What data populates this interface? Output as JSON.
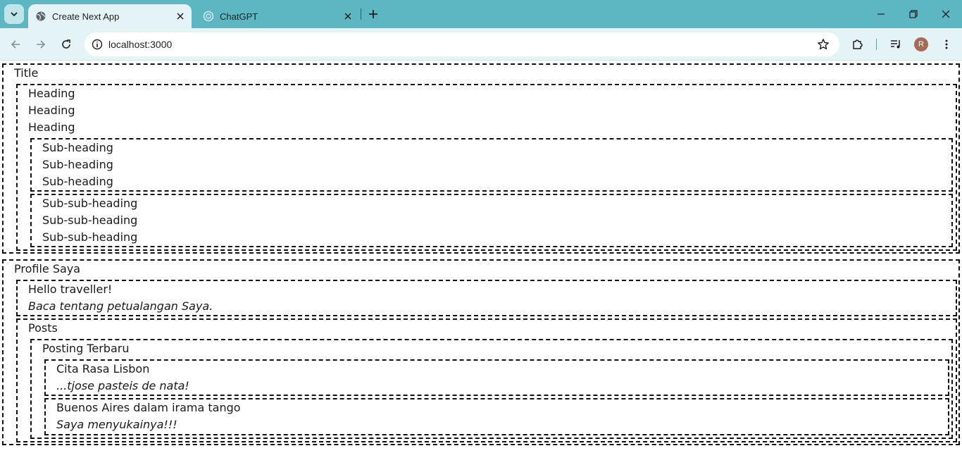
{
  "browser": {
    "tabs": [
      {
        "title": "Create Next App",
        "active": true
      },
      {
        "title": "ChatGPT",
        "active": false
      }
    ],
    "url": "localhost:3000",
    "profile_initial": "R",
    "accent": "#5db7c2",
    "toolbar_bg": "#e4f3f5"
  },
  "page": {
    "section1": {
      "title": "Title",
      "headings": [
        "Heading",
        "Heading",
        "Heading"
      ],
      "subheadings": [
        "Sub-heading",
        "Sub-heading",
        "Sub-heading"
      ],
      "subsubheadings": [
        "Sub-sub-heading",
        "Sub-sub-heading",
        "Sub-sub-heading"
      ]
    },
    "profile": {
      "title": "Profile Saya",
      "greeting": "Hello traveller!",
      "tagline": "Baca tentang petualangan Saya.",
      "posts_label": "Posts",
      "latest_label": "Posting Terbaru",
      "posts": [
        {
          "title": "Cita Rasa Lisbon",
          "excerpt": "...tjose pasteis de nata!"
        },
        {
          "title": "Buenos Aires dalam irama tango",
          "excerpt": "Saya menyukainya!!!"
        }
      ]
    }
  }
}
